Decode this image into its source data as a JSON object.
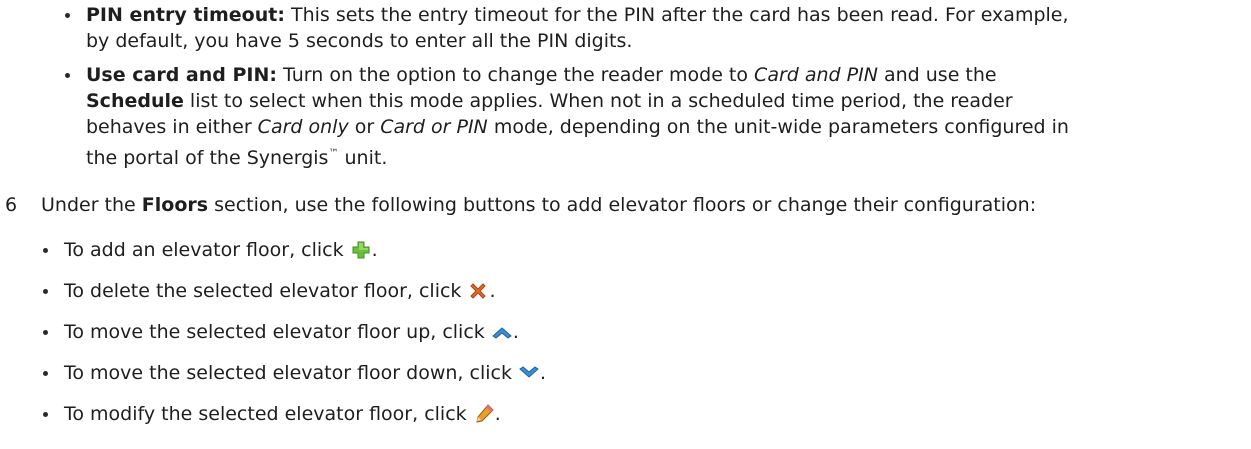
{
  "items": {
    "pin_timeout": {
      "title": "PIN entry timeout:",
      "text_l1": " This sets the entry timeout for the PIN after the card has been read. For example,",
      "text_l2": "by default, you have 5 seconds to enter all the PIN digits."
    },
    "use_card_pin": {
      "title": "Use card and PIN:",
      "l1_a": " Turn on the option to change the reader mode to ",
      "l1_em": "Card and PIN",
      "l1_b": " and use the",
      "l2_bold": "Schedule",
      "l2_rest": " list to select when this mode applies. When not in a scheduled time period, the reader",
      "l3_a": "behaves in either ",
      "l3_em1": "Card only",
      "l3_b": " or ",
      "l3_em2": "Card or PIN",
      "l3_c": " mode, depending on the unit-wide parameters configured in",
      "l4_a": "the portal of the Synergis",
      "l4_tm": "™",
      "l4_b": " unit."
    }
  },
  "step6": {
    "number": "6",
    "a": "Under the ",
    "bold": "Floors",
    "b": " section, use the following buttons to add elevator floors or change their configuration:"
  },
  "sub_items": [
    {
      "text": "To add an elevator floor, click ",
      "icon": "add-icon"
    },
    {
      "text": "To delete the selected elevator floor, click ",
      "icon": "delete-icon"
    },
    {
      "text": "To move the selected elevator floor up, click ",
      "icon": "move-up-icon"
    },
    {
      "text": "To move the selected elevator floor down, click ",
      "icon": "move-down-icon"
    },
    {
      "text": "To modify the selected elevator floor, click ",
      "icon": "edit-icon"
    }
  ],
  "period": ".",
  "colors": {
    "text": "#1e1e1e",
    "add_icon": "#6cbf3a",
    "delete_icon": "#e06a2c",
    "arrow_icon": "#3e8fd0",
    "edit_icon": "#e8a02a"
  }
}
